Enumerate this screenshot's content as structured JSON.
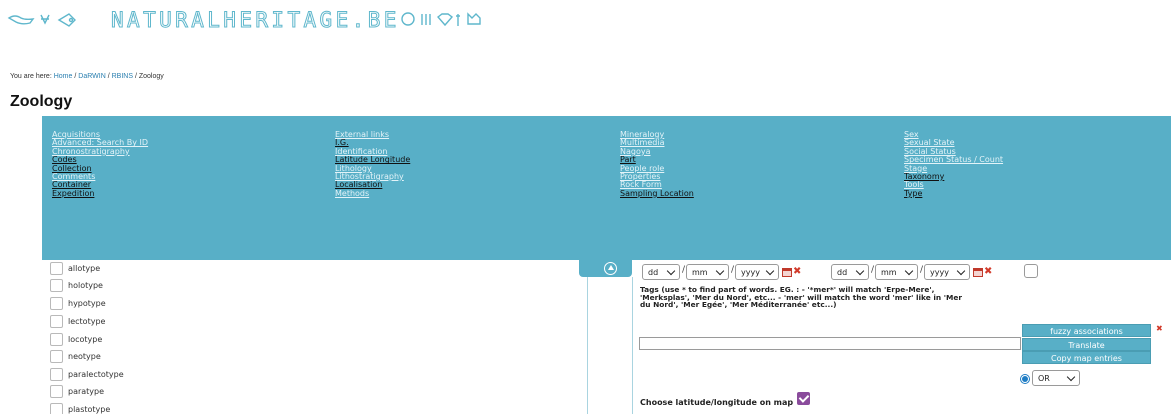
{
  "header": {
    "logo_text": "NATURALHERITAGE.BE"
  },
  "breadcrumb": {
    "prefix": "You are here: ",
    "home": "Home",
    "sep1": " / ",
    "darwin": "DaRWIN",
    "sep2": " / ",
    "rbins": "RBINS",
    "sep3": " / ",
    "current": "Zoology"
  },
  "page": {
    "title": "Zoology"
  },
  "criteria": {
    "col1": [
      "Acquisitions",
      "Advanced: Search By ID",
      "Chronostratigraphy",
      "Codes",
      "Collection",
      "Comments",
      "Container",
      "Expedition"
    ],
    "col2": [
      "External links",
      "I.G.",
      "Identification",
      "Latitude Longitude",
      "Lithology",
      "Lithostratigraphy",
      "Localisation",
      "Methods"
    ],
    "col3": [
      "Mineralogy",
      "Multimedia",
      "Nagoya",
      "Part",
      "People role",
      "Properties",
      "Rock Form",
      "Sampling Location"
    ],
    "col4": [
      "Sex",
      "Sexual State",
      "Social Status",
      "Specimen Status / Count",
      "Stage",
      "Taxonomy",
      "Tools",
      "Type"
    ]
  },
  "types": [
    "allotype",
    "holotype",
    "hypotype",
    "lectotype",
    "locotype",
    "neotype",
    "paralectotype",
    "paratype",
    "plastotype"
  ],
  "dates": {
    "from": {
      "day": "dd",
      "month": "mm",
      "year": "yyyy"
    },
    "to": {
      "day": "dd",
      "month": "mm",
      "year": "yyyy"
    },
    "slash": "/"
  },
  "tags": {
    "help": "Tags (use * to find part of words. EG. : - '*mer*' will match 'Erpe-Mere', 'Merksplas', 'Mer du Nord', etc... - 'mer' will match the word 'mer' like in 'Mer du Nord', 'Mer Egée', 'Mer Méditerranée' etc...)",
    "input_value": "",
    "fuzzy": "fuzzy associations",
    "translate": "Translate",
    "copy_map": "Copy map entries",
    "operator": "OR"
  },
  "coords": {
    "label": "Choose latitude/longitude on map"
  },
  "colors": {
    "accent": "#58afc7",
    "check": "#8a4b9c",
    "remove": "#d23a2a"
  },
  "icons": [
    "calendar-icon",
    "remove-icon",
    "collapse-icon",
    "chevron-down-icon"
  ]
}
